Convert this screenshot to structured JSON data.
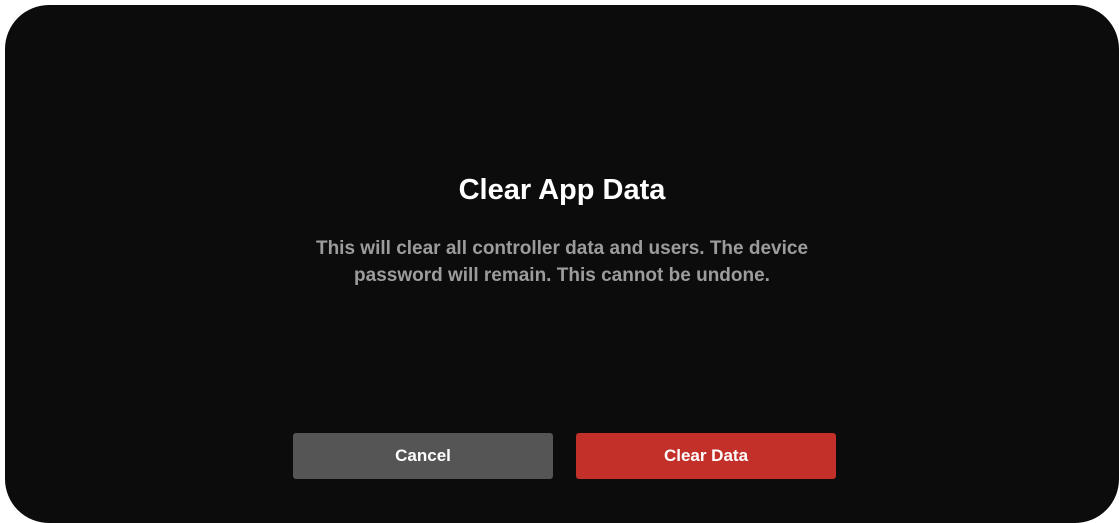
{
  "dialog": {
    "title": "Clear App Data",
    "message": "This will clear all controller data and users. The device password will remain. This cannot be undone.",
    "cancel_label": "Cancel",
    "confirm_label": "Clear Data"
  },
  "colors": {
    "dialog_background": "#0c0c0c",
    "title_text": "#ffffff",
    "message_text": "#9c9c9c",
    "cancel_button": "#555555",
    "confirm_button": "#c3302a"
  }
}
